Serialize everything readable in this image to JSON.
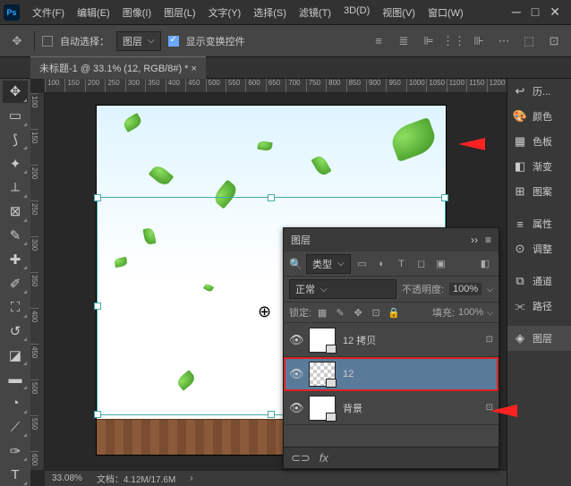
{
  "menubar": {
    "items": [
      "文件(F)",
      "编辑(E)",
      "图像(I)",
      "图层(L)",
      "文字(Y)",
      "选择(S)",
      "滤镜(T)",
      "3D(D)",
      "视图(V)",
      "窗口(W)"
    ]
  },
  "optionbar": {
    "auto_select": "自动选择：",
    "layer_dd": "图层",
    "show_transform": "显示变换控件"
  },
  "doctab": {
    "label": "未标题-1 @ 33.1% (12, RGB/8#) *"
  },
  "ruler_h": [
    100,
    150,
    200,
    250,
    300,
    350,
    400,
    450,
    500,
    550,
    600,
    650,
    700,
    750,
    800,
    850,
    900,
    950,
    1000,
    1050,
    1100,
    1150,
    1200
  ],
  "ruler_v": [
    100,
    150,
    200,
    250,
    300,
    350,
    400,
    450,
    500,
    550,
    600
  ],
  "status": {
    "zoom": "33.08%",
    "doc": "文档：4.12M/17.6M"
  },
  "rightpanels": [
    {
      "icon": "↩",
      "label": "历..."
    },
    {
      "icon": "🎨",
      "label": "颜色"
    },
    {
      "icon": "▦",
      "label": "色板"
    },
    {
      "icon": "◧",
      "label": "渐变"
    },
    {
      "icon": "⊞",
      "label": "图案"
    },
    {
      "sep": true
    },
    {
      "icon": "≡",
      "label": "属性"
    },
    {
      "icon": "⊙",
      "label": "调整"
    },
    {
      "sep": true
    },
    {
      "icon": "⧉",
      "label": "通道"
    },
    {
      "icon": "⫘",
      "label": "路径"
    },
    {
      "sep": true
    },
    {
      "icon": "◈",
      "label": "图层",
      "sel": true
    }
  ],
  "layers_panel": {
    "title": "图层",
    "type_dd": "类型",
    "blend": "正常",
    "opacity_label": "不透明度:",
    "opacity": "100%",
    "lock_label": "锁定:",
    "fill_label": "填充:",
    "fill": "100%",
    "layers": [
      {
        "name": "12 拷贝",
        "thumb": "leaves"
      },
      {
        "name": "12",
        "thumb": "trans",
        "sel": true
      },
      {
        "name": "背景",
        "thumb": "white"
      }
    ]
  },
  "chart_data": null
}
